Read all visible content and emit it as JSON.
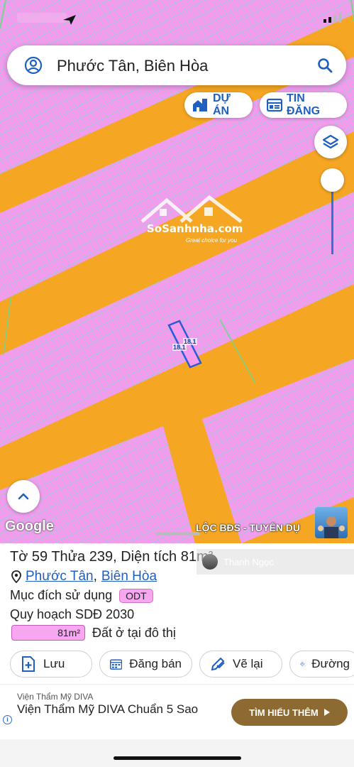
{
  "search": {
    "query": "Phước Tân, Biên Hòa"
  },
  "chips": {
    "du_an": "DỰ ÁN",
    "tin_dang": "TIN ĐĂNG"
  },
  "map": {
    "watermark_brand": "SoSanhnha.com",
    "watermark_tagline": "Great choice for you",
    "parcel_dim_a": "18.1",
    "parcel_dim_b": "18.1",
    "attribution": "Google",
    "overlay_text": "LỘC BĐS - TUYỂN DỤ",
    "colors": {
      "road": "#f5a623",
      "parcel": "#f49bee",
      "parcel_line": "#8fd0d6",
      "selected": "#2a5bd7"
    }
  },
  "viewer": {
    "name": "Thanh Ngọc"
  },
  "sheet": {
    "title": "Tờ 59 Thửa 239, Diện tích 81m²",
    "ward": "Phước Tân",
    "separator": ",",
    "city": "Biên Hòa",
    "purpose_label": "Mục đích sử dụng",
    "purpose_code": "ODT",
    "plan_label": "Quy hoạch SDĐ 2030",
    "area_value": "81m²",
    "area_desc": "Đất ở tại đô thị"
  },
  "actions": {
    "save": "Lưu",
    "post": "Đăng bán",
    "redraw": "Vẽ lại",
    "route": "Đường"
  },
  "ad": {
    "advertiser": "Viện Thẩm Mỹ DIVA",
    "headline": "Viện Thẩm Mỹ DIVA Chuẩn 5 Sao",
    "cta": "TÌM HIỂU THÊM",
    "info_icon": "i"
  }
}
